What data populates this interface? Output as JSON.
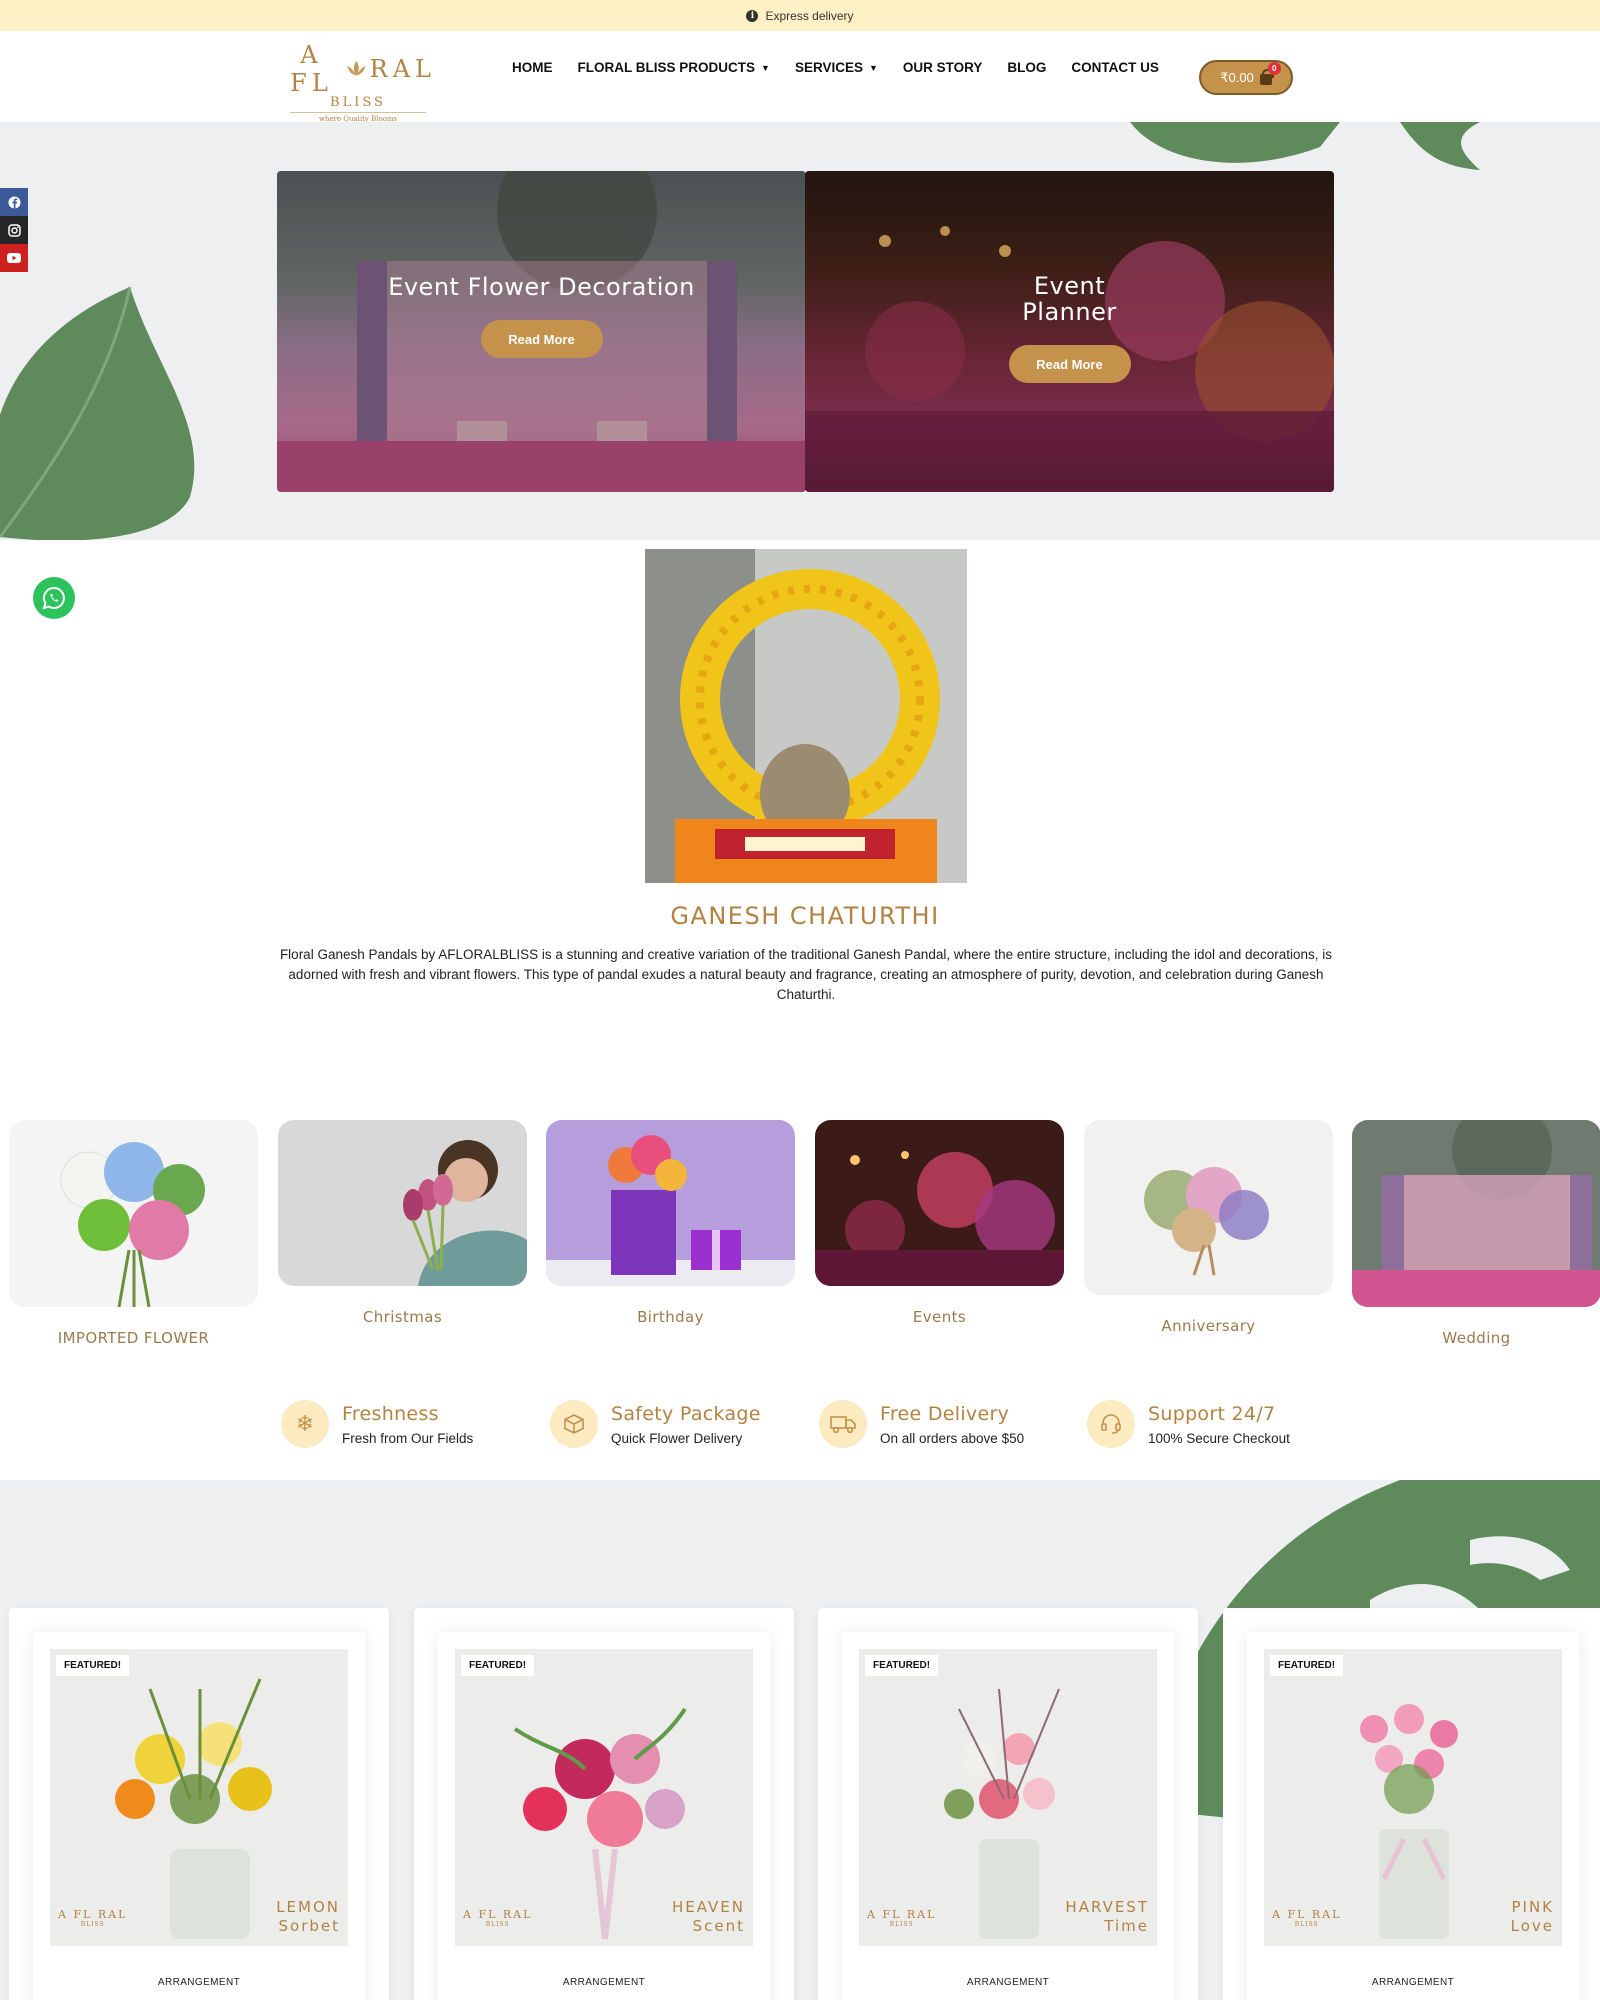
{
  "topbar": {
    "text": "Express delivery",
    "icon": "info-icon"
  },
  "logo": {
    "line1_left": "A FL",
    "line1_right": "RAL",
    "line2": "BLISS",
    "tagline": "where Quality Blooms"
  },
  "nav": {
    "items": [
      {
        "label": "HOME"
      },
      {
        "label": "FLORAL BLISS PRODUCTS",
        "dropdown": true
      },
      {
        "label": "SERVICES",
        "dropdown": true
      },
      {
        "label": "OUR STORY"
      },
      {
        "label": "BLOG"
      },
      {
        "label": "CONTACT US"
      }
    ],
    "dropdown_glyph": "⌄"
  },
  "cart": {
    "amount": "₹0.00",
    "count": "0"
  },
  "social": [
    "facebook-icon",
    "instagram-icon",
    "youtube-icon"
  ],
  "hero": {
    "cards": [
      {
        "title_line1": "Event Flower Decoration",
        "title_line2": "",
        "button": "Read More"
      },
      {
        "title_line1": "Event",
        "title_line2": "Planner",
        "button": "Read More"
      }
    ]
  },
  "ganesh": {
    "title": "GANESH CHATURTHI",
    "description": "Floral Ganesh Pandals by AFLORALBLISS is a stunning and creative variation of the traditional Ganesh Pandal, where the entire structure, including the idol and decorations, is adorned with fresh and vibrant flowers. This type of pandal exudes a natural beauty and fragrance, creating an atmosphere of purity, devotion, and celebration during Ganesh Chaturthi."
  },
  "categories": [
    {
      "label": "IMPORTED FLOWER"
    },
    {
      "label": "Christmas"
    },
    {
      "label": "Birthday"
    },
    {
      "label": "Events"
    },
    {
      "label": "Anniversary"
    },
    {
      "label": "Wedding"
    }
  ],
  "features": [
    {
      "title": "Freshness",
      "subtitle": "Fresh from Our Fields",
      "icon": "snowflake-icon"
    },
    {
      "title": "Safety Package",
      "subtitle": "Quick Flower Delivery",
      "icon": "package-icon"
    },
    {
      "title": "Free Delivery",
      "subtitle": "On all orders above $50",
      "icon": "truck-icon"
    },
    {
      "title": "Support 24/7",
      "subtitle": "100% Secure Checkout",
      "icon": "support-icon"
    }
  ],
  "products": [
    {
      "badge": "FEATURED!",
      "category": "ARRANGEMENT",
      "name_line1": "LEMON",
      "name_line2": "Sorbet",
      "logo": "A FL RAL",
      "logo_sub": "BLISS"
    },
    {
      "badge": "FEATURED!",
      "category": "ARRANGEMENT",
      "name_line1": "HEAVEN",
      "name_line2": "Scent",
      "logo": "A FL RAL",
      "logo_sub": "BLISS"
    },
    {
      "badge": "FEATURED!",
      "category": "ARRANGEMENT",
      "name_line1": "HARVEST",
      "name_line2": "Time",
      "logo": "A FL RAL",
      "logo_sub": "BLISS"
    },
    {
      "badge": "FEATURED!",
      "category": "ARRANGEMENT",
      "name_line1": "PINK",
      "name_line2": "Love",
      "logo": "A FL RAL",
      "logo_sub": "BLISS"
    }
  ],
  "colors": {
    "accent": "#c4924a",
    "gold_text": "#b28243",
    "topbar": "#fcf1c4",
    "section_bg": "#eeeff1",
    "whatsapp": "#2cc25c"
  }
}
